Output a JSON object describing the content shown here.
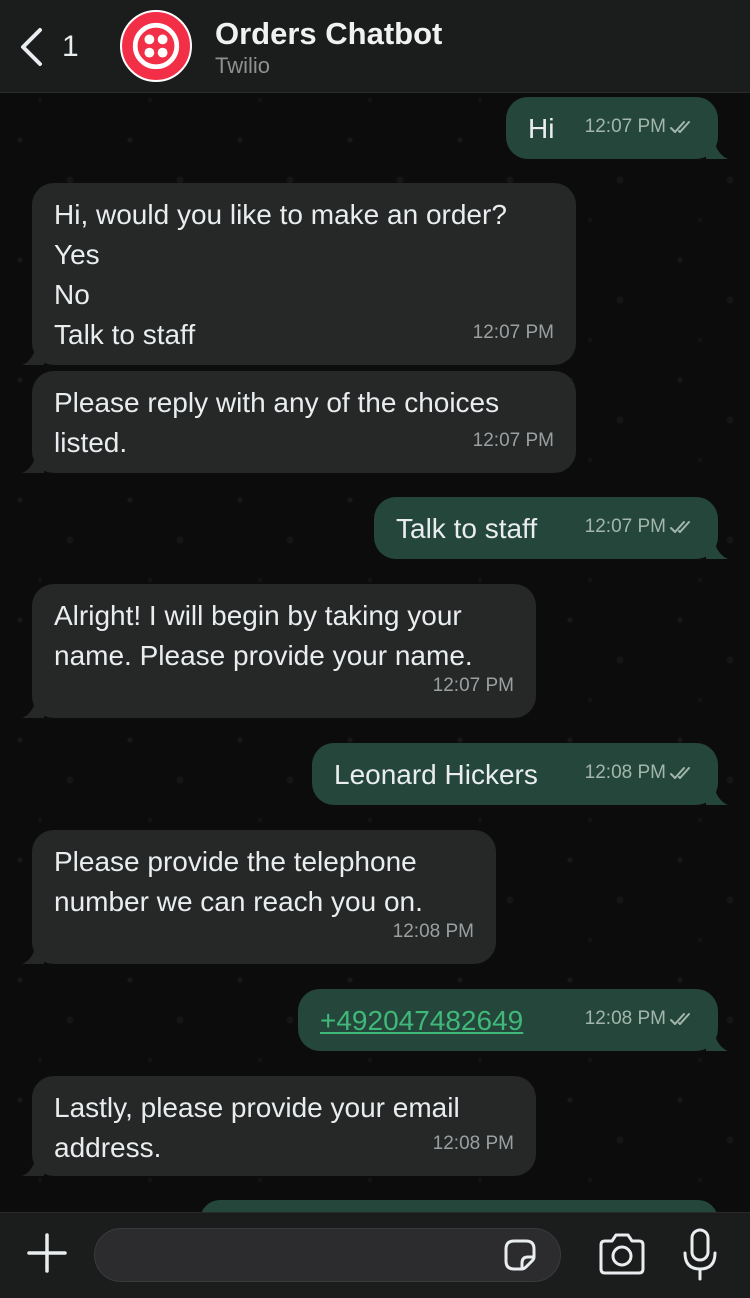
{
  "header": {
    "back_count": "1",
    "title": "Orders Chatbot",
    "subtitle": "Twilio",
    "avatar_color": "#f22f46"
  },
  "messages": [
    {
      "direction": "outgoing",
      "lines": [
        "Hi"
      ],
      "time": "12:07 PM",
      "read": true
    },
    {
      "direction": "incoming",
      "lines": [
        "Hi, would you like to make an order?",
        "Yes",
        "No",
        "Talk to staff"
      ],
      "time": "12:07 PM"
    },
    {
      "direction": "incoming",
      "lines": [
        "Please reply with any of the choices",
        "listed."
      ],
      "time": "12:07 PM"
    },
    {
      "direction": "outgoing",
      "lines": [
        "Talk to staff"
      ],
      "time": "12:07 PM",
      "read": true
    },
    {
      "direction": "incoming",
      "lines": [
        "Alright! I will begin by taking your",
        "name. Please provide your name."
      ],
      "time": "12:07 PM"
    },
    {
      "direction": "outgoing",
      "lines": [
        "Leonard Hickers"
      ],
      "time": "12:08 PM",
      "read": true
    },
    {
      "direction": "incoming",
      "lines": [
        "Please provide the telephone",
        "number we can reach you on."
      ],
      "time": "12:08 PM"
    },
    {
      "direction": "outgoing",
      "lines": [
        "+492047482649"
      ],
      "time": "12:08 PM",
      "read": true,
      "is_link": true
    },
    {
      "direction": "incoming",
      "lines": [
        "Lastly, please provide your email",
        "address."
      ],
      "time": "12:08 PM"
    }
  ],
  "input": {
    "value": "",
    "placeholder": ""
  },
  "icons": {
    "back": "chevron-left-icon",
    "plus": "plus-icon",
    "sticker": "sticker-icon",
    "camera": "camera-icon",
    "mic": "microphone-icon",
    "read_receipt": "double-check-icon"
  },
  "colors": {
    "incoming_bubble": "#262727",
    "outgoing_bubble": "#25463a",
    "link": "#3fb87a",
    "header_bg": "#1b1c1c"
  }
}
